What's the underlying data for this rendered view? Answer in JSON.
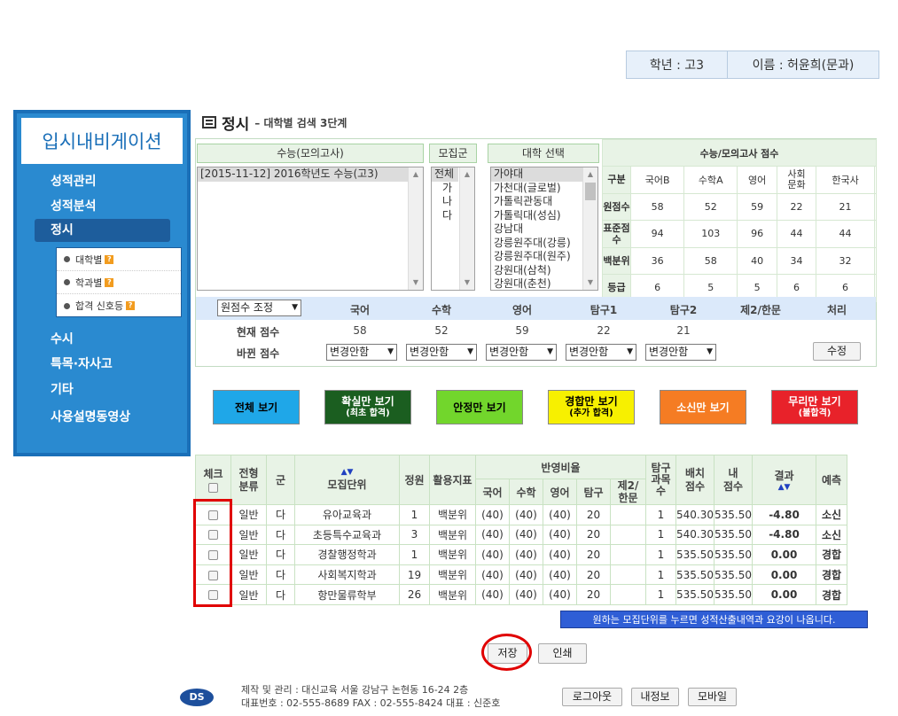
{
  "user": {
    "grade": "학년 : 고3",
    "name": "이름 : 허윤희(문과)"
  },
  "sidebar": {
    "logo": "입시내비게이션",
    "menu": [
      "성적관리",
      "성적분석",
      "정시",
      "수시",
      "특목·자사고",
      "기타",
      "사용설명동영상"
    ],
    "submenu": [
      "대학별",
      "학과별",
      "합격 신호등"
    ]
  },
  "header": {
    "title": "정시",
    "subtitle": "– 대학별 검색 3단계"
  },
  "selector": {
    "exam_head": "수능(모의고사)",
    "exam_options": [
      "[2015-11-12]  2016학년도 수능(고3)"
    ],
    "group_head": "모집군",
    "group_options": [
      "전체",
      "가",
      "나",
      "다"
    ],
    "univ_head": "대학 선택",
    "univ_options": [
      "가야대",
      "가천대(글로벌)",
      "가톨릭관동대",
      "가톨릭대(성심)",
      "강남대",
      "강릉원주대(강릉)",
      "강릉원주대(원주)",
      "강원대(삼척)",
      "강원대(춘천)"
    ]
  },
  "score_table": {
    "title": "수능/모의고사 점수",
    "row_header": "구분",
    "columns": [
      "국어B",
      "수학A",
      "영어",
      "사회\n문화",
      "한국사",
      ""
    ],
    "rows": [
      {
        "label": "원점수",
        "values": [
          "58",
          "52",
          "59",
          "22",
          "21",
          ""
        ]
      },
      {
        "label": "표준점수",
        "values": [
          "94",
          "103",
          "96",
          "44",
          "44",
          ""
        ]
      },
      {
        "label": "백분위",
        "values": [
          "36",
          "58",
          "40",
          "34",
          "32",
          ""
        ]
      },
      {
        "label": "등급",
        "values": [
          "6",
          "5",
          "5",
          "6",
          "6",
          ""
        ]
      }
    ]
  },
  "adjust": {
    "mode_select": "원점수 조정",
    "headers": [
      "국어",
      "수학",
      "영어",
      "탐구1",
      "탐구2",
      "제2/한문",
      "처리"
    ],
    "current_label": "현재 점수",
    "current_values": [
      "58",
      "52",
      "59",
      "22",
      "21"
    ],
    "changed_label": "바뀐 점수",
    "changed_select": "변경안함",
    "edit_button": "수정"
  },
  "filters": [
    {
      "label": "전체 보기",
      "sub": "",
      "bg": "#1fa7e8",
      "color": "#000"
    },
    {
      "label": "확실만 보기",
      "sub": "(최초 합격)",
      "bg": "#1b5e20",
      "color": "#fff"
    },
    {
      "label": "안정만 보기",
      "sub": "",
      "bg": "#72d62c",
      "color": "#000"
    },
    {
      "label": "경합만 보기",
      "sub": "(추가 합격)",
      "bg": "#f7f000",
      "color": "#000"
    },
    {
      "label": "소신만 보기",
      "sub": "",
      "bg": "#f57c23",
      "color": "#fff"
    },
    {
      "label": "무리만 보기",
      "sub": "(불합격)",
      "bg": "#e8222a",
      "color": "#fff"
    }
  ],
  "results": {
    "headers": {
      "check": "체크",
      "type": "전형\n분류",
      "group": "군",
      "unit": "모집단위",
      "quota": "정원",
      "indicator": "활용지표",
      "ratio": "반영비율",
      "ratio_sub": [
        "국어",
        "수학",
        "영어",
        "탐구",
        "제2/\n한문"
      ],
      "subjects": "탐구\n과목\n수",
      "alloc": "배치\n점수",
      "mine": "내\n점수",
      "result": "결과",
      "predict": "예측"
    },
    "rows": [
      {
        "type": "일반",
        "group": "다",
        "unit": "유아교육과",
        "quota": "1",
        "indicator": "백분위",
        "kor": "(40)",
        "math": "(40)",
        "eng": "(40)",
        "inq": "20",
        "second": "",
        "subj": "1",
        "alloc": "540.30",
        "mine": "535.50",
        "result": "-4.80",
        "predict": "소신"
      },
      {
        "type": "일반",
        "group": "다",
        "unit": "초등특수교육과",
        "quota": "3",
        "indicator": "백분위",
        "kor": "(40)",
        "math": "(40)",
        "eng": "(40)",
        "inq": "20",
        "second": "",
        "subj": "1",
        "alloc": "540.30",
        "mine": "535.50",
        "result": "-4.80",
        "predict": "소신"
      },
      {
        "type": "일반",
        "group": "다",
        "unit": "경찰행정학과",
        "quota": "1",
        "indicator": "백분위",
        "kor": "(40)",
        "math": "(40)",
        "eng": "(40)",
        "inq": "20",
        "second": "",
        "subj": "1",
        "alloc": "535.50",
        "mine": "535.50",
        "result": "0.00",
        "predict": "경합"
      },
      {
        "type": "일반",
        "group": "다",
        "unit": "사회복지학과",
        "quota": "19",
        "indicator": "백분위",
        "kor": "(40)",
        "math": "(40)",
        "eng": "(40)",
        "inq": "20",
        "second": "",
        "subj": "1",
        "alloc": "535.50",
        "mine": "535.50",
        "result": "0.00",
        "predict": "경합"
      },
      {
        "type": "일반",
        "group": "다",
        "unit": "항만물류학부",
        "quota": "26",
        "indicator": "백분위",
        "kor": "(40)",
        "math": "(40)",
        "eng": "(40)",
        "inq": "20",
        "second": "",
        "subj": "1",
        "alloc": "535.50",
        "mine": "535.50",
        "result": "0.00",
        "predict": "경합"
      }
    ]
  },
  "note": "원하는 모집단위를 누르면 성적산출내역과 요강이 나옵니다.",
  "actions": {
    "save": "저장",
    "print": "인쇄"
  },
  "footer": {
    "logo": "DS",
    "line1": "제작 및 관리 : 대신교육 서울 강남구 논현동 16-24 2층",
    "line2": "대표번호 : 02-555-8689    FAX : 02-555-8424    대표 : 신준호",
    "buttons": [
      "로그아웃",
      "내정보",
      "모바일"
    ]
  },
  "colors": {
    "accent": "#2a8ad0",
    "table_header": "#e8f3e6",
    "danger": "#e00000",
    "warn": "#e08000"
  }
}
